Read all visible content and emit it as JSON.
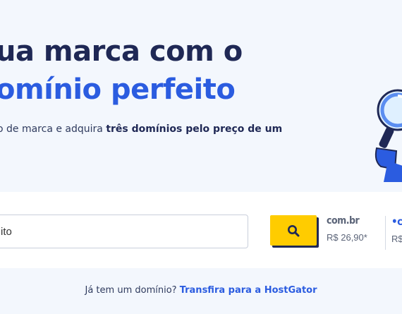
{
  "hero": {
    "headline_line1": "ua marca com o",
    "headline_line2": "omínio perfeito",
    "subtitle_prefix": "o de marca e adquira ",
    "subtitle_bold": "três domínios pelo preço de um"
  },
  "search": {
    "input_value": "ito",
    "search_icon": "search-icon",
    "accent_color": "#ffcc00"
  },
  "tlds": [
    {
      "name": "com.br",
      "price": "R$ 26,90*"
    },
    {
      "name": "•c",
      "price": "R$"
    }
  ],
  "footer": {
    "question": "Já tem um domínio? ",
    "link_text": "Transfira para a HostGator"
  },
  "colors": {
    "navy": "#1f2855",
    "blue": "#2b5ce0",
    "background": "#f3f7fd"
  }
}
